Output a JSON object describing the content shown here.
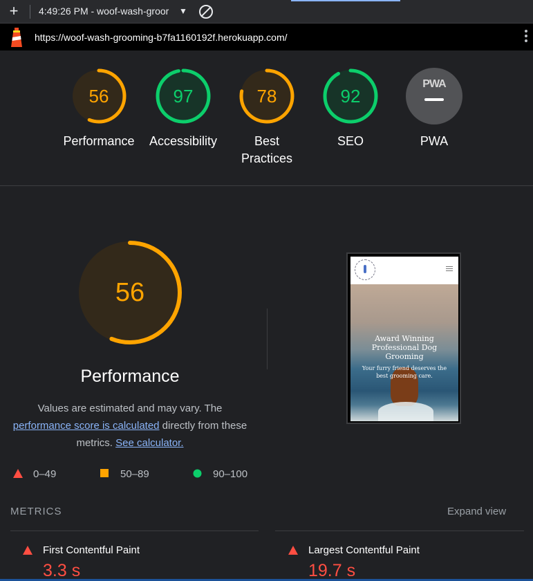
{
  "toolbar": {
    "report_title": "4:49:26 PM - woof-wash-groor",
    "add_icon": "plus-icon",
    "clear_icon": "clear-icon"
  },
  "urlbar": {
    "url": "https://woof-wash-grooming-b7fa1160192f.herokuapp.com/",
    "logo_icon": "lighthouse-icon",
    "menu_icon": "kebab-menu-icon"
  },
  "gauges": [
    {
      "label": "Performance",
      "score": "56",
      "color": "#ffa400"
    },
    {
      "label": "Accessibility",
      "score": "97",
      "color": "#0cce6b"
    },
    {
      "label": "Best Practices",
      "score": "78",
      "color": "#ffa400"
    },
    {
      "label": "SEO",
      "score": "92",
      "color": "#0cce6b"
    },
    {
      "label": "PWA",
      "score": "PWA",
      "color": "#525356"
    }
  ],
  "performance": {
    "score": "56",
    "title": "Performance",
    "desc_1": "Values are estimated and may vary. The",
    "link_1": "performance score is calculated",
    "desc_2": " directly from these metrics.",
    "link_2": "See calculator."
  },
  "legend": [
    {
      "range": "0–49",
      "color": "#ff4e42"
    },
    {
      "range": "50–89",
      "color": "#ffa400"
    },
    {
      "range": "90–100",
      "color": "#0cce6b"
    }
  ],
  "screenshot": {
    "headline": "Award Winning Professional Dog Grooming",
    "subline": "Your furry friend deserves the best grooming care."
  },
  "metrics": {
    "heading": "METRICS",
    "expand_label": "Expand view",
    "items": [
      {
        "label": "First Contentful Paint",
        "value": "3.3 s"
      },
      {
        "label": "Largest Contentful Paint",
        "value": "19.7 s"
      }
    ]
  }
}
